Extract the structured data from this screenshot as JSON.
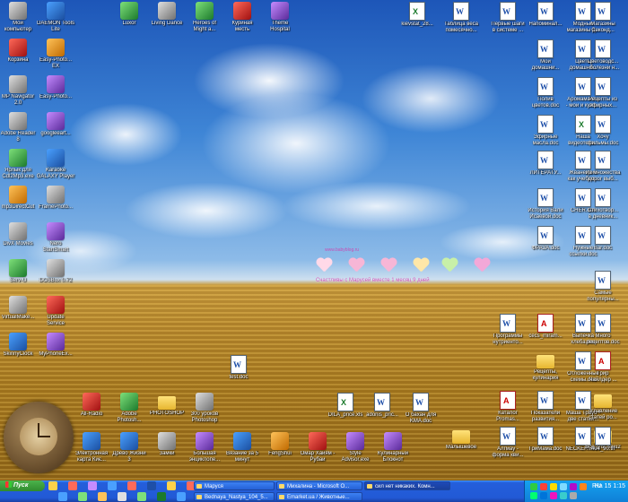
{
  "desktop_icons": {
    "left": [
      {
        "label": "Мой\nкомпьютер",
        "icon": "computer-icon"
      },
      {
        "label": "DAEMON Tools\nLite",
        "icon": "daemon-tools-icon"
      },
      {
        "label": "Корзина",
        "icon": "recycle-bin-icon"
      },
      {
        "label": "Easy-Photo...\nEX",
        "icon": "easy-photo-icon"
      },
      {
        "label": "MP Navigator\n2.0",
        "icon": "mp-navigator-icon"
      },
      {
        "label": "Easy-Photo...",
        "icon": "easy-photo-2-icon"
      },
      {
        "label": "Adobe Reader\n8",
        "icon": "adobe-reader-icon"
      },
      {
        "label": "googleeart...",
        "icon": "google-earth-icon"
      },
      {
        "label": "Ярлык для\nCdl2Mp3.exe",
        "icon": "shortcut-icon"
      },
      {
        "label": "Karaoke\nGALAXY Player",
        "icon": "karaoke-icon"
      },
      {
        "label": "mp3DirectCut",
        "icon": "mp3directcut-icon"
      },
      {
        "label": "FramePhoto...",
        "icon": "framephoto-icon"
      },
      {
        "label": "DivX Movies",
        "icon": "divx-icon"
      },
      {
        "label": "Nero\nStartSmart",
        "icon": "nero-icon"
      },
      {
        "label": "Serv-U",
        "icon": "serv-u-icon"
      },
      {
        "label": "DOSBox 0.72",
        "icon": "dosbox-icon"
      },
      {
        "label": "VirtualMake...",
        "icon": "virtualmake-icon"
      },
      {
        "label": "Update\nService",
        "icon": "update-service-icon"
      },
      {
        "label": "SkinnyClock",
        "icon": "skinnyclock-icon"
      },
      {
        "label": "MyPhoneEx...",
        "icon": "myphone-icon"
      }
    ],
    "top_row": [
      {
        "label": "Luxor",
        "icon": "luxor-icon"
      },
      {
        "label": "Living Dance",
        "icon": "living-dance-icon"
      },
      {
        "label": "Heroes of\nMight a...",
        "icon": "heroes-icon"
      },
      {
        "label": "Куриная\nместь",
        "icon": "chicken-icon"
      },
      {
        "label": "Theme\nHospital",
        "icon": "theme-hospital-icon"
      }
    ],
    "right_grid": [
      {
        "label": "kievstat_28...",
        "icon": "xls-icon"
      },
      {
        "label": "Таблица веса\nпомесячно...",
        "icon": "doc-icon"
      },
      {
        "label": "Первые шаги\nв системе ...",
        "icon": "doc-icon"
      },
      {
        "label": "Напоминал...",
        "icon": "doc-icon"
      },
      {
        "label": "Модные\nмагазины д...",
        "icon": "doc-icon"
      },
      {
        "label": "Магазины\nСеконд...",
        "icon": "doc-icon"
      },
      {
        "label": "Мои\nдомашни...",
        "icon": "doc-icon"
      },
      {
        "label": "Цветы\nдомашни...",
        "icon": "doc-icon"
      },
      {
        "label": "Цветоводс...\n- болезни н...",
        "icon": "doc-icon"
      },
      {
        "label": "Полив\nцветов.doc",
        "icon": "doc-icon"
      },
      {
        "label": "Аромамасла\n- мои и купл...",
        "icon": "doc-icon"
      },
      {
        "label": "Рецепты из\nэфирных...",
        "icon": "doc-icon"
      },
      {
        "label": "Эфирные\nмасла.doc",
        "icon": "doc-icon"
      },
      {
        "label": "Наша\nвидеотека...",
        "icon": "xls-icon"
      },
      {
        "label": "Хочу\nфильмы.doc",
        "icon": "doc-icon"
      },
      {
        "label": "ЛИТЕРАТУ...",
        "icon": "doc-icon"
      },
      {
        "label": "Жванецкий\nкак учебни...",
        "icon": "doc-icon"
      },
      {
        "label": "Из множества\nдорог выб...",
        "icon": "doc-icon"
      },
      {
        "label": "История Вали\nИсаевой.doc",
        "icon": "doc-icon"
      },
      {
        "label": "CHER.doc",
        "icon": "doc-icon"
      },
      {
        "label": "Стихотвор...\nв дневник...",
        "icon": "doc-icon"
      },
      {
        "label": "ФРАЗА.doc",
        "icon": "doc-icon"
      },
      {
        "label": "Нужные\nссылки.doc",
        "icon": "doc-icon"
      },
      {
        "label": "Bar.doc",
        "icon": "doc-icon"
      },
      {
        "label": "Самые\nпопулярны...",
        "icon": "doc-icon"
      },
      {
        "label": "Программы\nнутриенто...",
        "icon": "doc-icon"
      },
      {
        "label": "cecs_miram...",
        "icon": "pdf-icon"
      },
      {
        "label": "Выпечка\nхлеба.doc",
        "icon": "doc-icon"
      },
      {
        "label": "Много\nрецептов.doc",
        "icon": "doc-icon"
      },
      {
        "label": "Рецепты,\nкулинария",
        "icon": "folder-icon"
      },
      {
        "label": "Отложенные\nсхемы.doc",
        "icon": "doc-icon"
      },
      {
        "label": "Грир\nЧайлдер ...",
        "icon": "pdf-icon"
      },
      {
        "label": "Каталог\nPromas...",
        "icon": "pdf-icon"
      },
      {
        "label": "Показатели\nразвития...",
        "icon": "doc-icon"
      },
      {
        "label": "Маша Трауб -\nдве статьи...",
        "icon": "doc-icon"
      },
      {
        "label": "оглавление\nстатей ро...",
        "icon": "folder-icon"
      },
      {
        "label": "Малышевое",
        "icon": "folder-icon"
      },
      {
        "label": "Алгмау -\nформа кви...",
        "icon": "doc-icon"
      },
      {
        "label": "ГриМама.doc",
        "icon": "doc-icon"
      },
      {
        "label": "NECKERMA...",
        "icon": "doc-icon"
      },
      {
        "label": "Все для Saш2",
        "icon": "folder-icon"
      },
      {
        "label": "404_90.tif",
        "icon": "doc-icon"
      }
    ],
    "middle": [
      {
        "label": "test.doc",
        "icon": "doc-icon"
      },
      {
        "label": "DILA_price.xls",
        "icon": "xls-icon"
      },
      {
        "label": "adonis_pric...",
        "icon": "doc-icon"
      },
      {
        "label": "О бахан для\nKMA.doc",
        "icon": "doc-icon"
      }
    ],
    "bottom_row1": [
      {
        "label": "All-Radio",
        "icon": "all-radio-icon"
      },
      {
        "label": "Adobe\nPhotosh...",
        "icon": "photoshop-icon"
      },
      {
        "label": "PHOTOSHOP",
        "icon": "photoshop-folder-icon"
      },
      {
        "label": "300 уроков\nPhotoshop",
        "icon": "lessons-icon"
      }
    ],
    "bottom_row2": [
      {
        "label": "Электронная\nкарта Киє...",
        "icon": "map-icon"
      },
      {
        "label": "Древо Жизни\n3",
        "icon": "tree-icon"
      },
      {
        "label": "Замки",
        "icon": "castles-icon"
      },
      {
        "label": "Большая\nэнциклопе...",
        "icon": "encyclopedia-icon"
      },
      {
        "label": "Вязание за 5\nминут",
        "icon": "knitting-icon"
      },
      {
        "label": "FengShui",
        "icon": "fengshui-icon"
      },
      {
        "label": "Омар Хайям -\nРубаи",
        "icon": "omar-icon"
      },
      {
        "label": "Style\nAdvisor.exe",
        "icon": "style-advisor-icon"
      },
      {
        "label": "Кулинарный\nБлокнот",
        "icon": "cook-icon"
      }
    ]
  },
  "ticker": {
    "url": "www.babyblog.ru",
    "text": "Счастливы с Марусей вместе 1 месяц 9 дней"
  },
  "taskbar": {
    "start_label": "Пуск",
    "tasks": [
      {
        "label": "Маруся",
        "active": false
      },
      {
        "label": "Bednaya_Nastya_104_5...",
        "active": false
      },
      {
        "label": "Михалина - Microsoft O...",
        "active": false
      },
      {
        "label": "Emarket.ua / Животные...",
        "active": false
      },
      {
        "label": "сил нет никаких. Комн...",
        "active": true
      }
    ],
    "language": "RU",
    "clock": "1:15",
    "date_label": "На 15"
  },
  "colors": {
    "taskbar": "#245edb",
    "start": "#2f8a2f",
    "tray": "#0f7fd6",
    "ticker_text": "#c54fb5"
  }
}
